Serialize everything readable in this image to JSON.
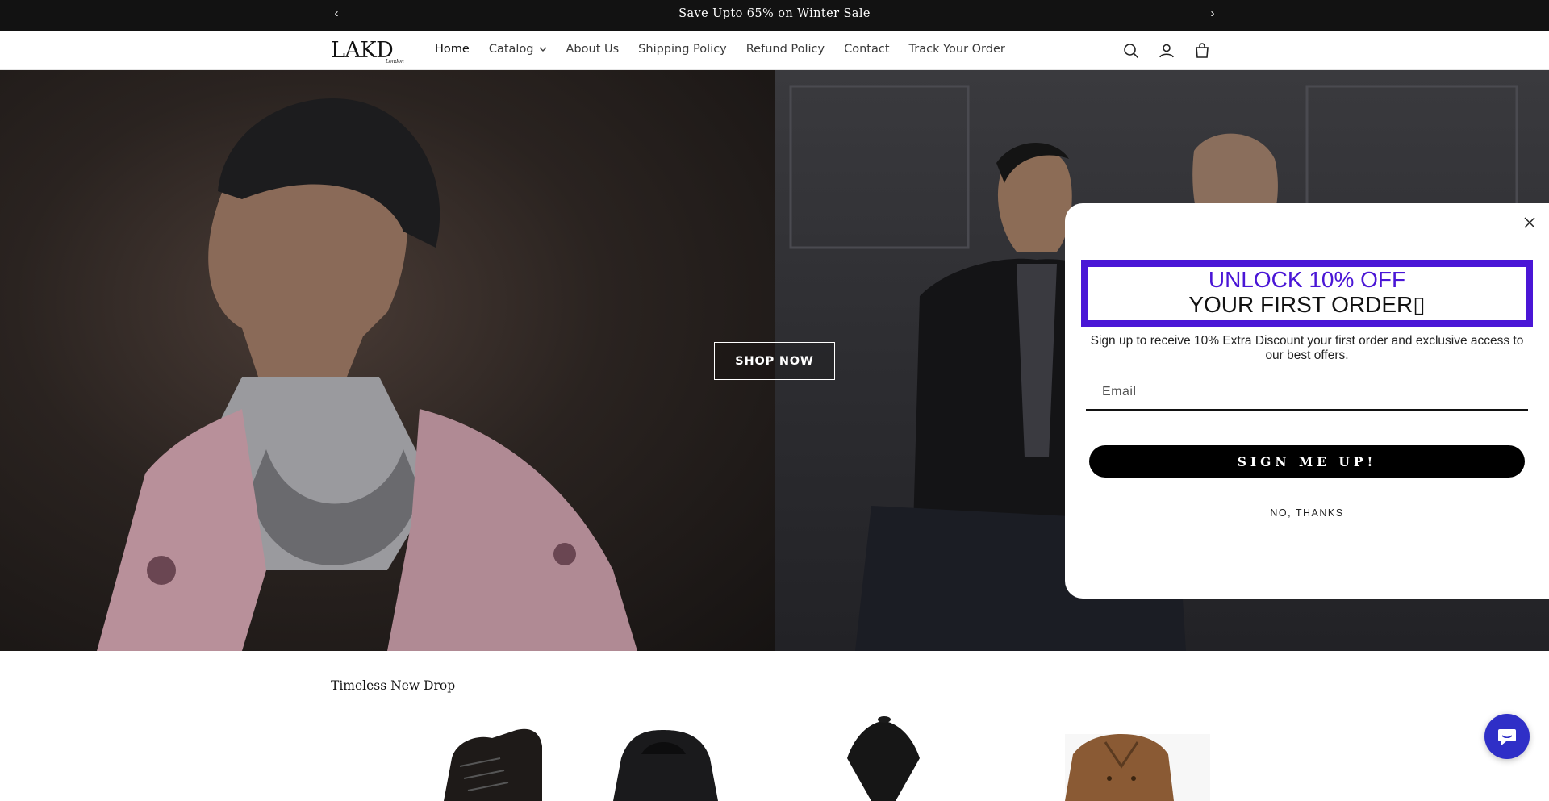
{
  "announcement": {
    "message": "Save Upto 65% on Winter Sale",
    "prev_icon": "chevron-left-icon",
    "next_icon": "chevron-right-icon"
  },
  "header": {
    "logo_text": "LAKD",
    "logo_subtext": "London",
    "nav": [
      {
        "label": "Home",
        "active": true
      },
      {
        "label": "Catalog",
        "has_dropdown": true
      },
      {
        "label": "About Us"
      },
      {
        "label": "Shipping Policy"
      },
      {
        "label": "Refund Policy"
      },
      {
        "label": "Contact"
      },
      {
        "label": "Track Your Order"
      }
    ],
    "icons": [
      "search-icon",
      "account-icon",
      "cart-icon"
    ]
  },
  "hero": {
    "cta_label": "SHOP NOW"
  },
  "popup": {
    "headline_line1": "UNLOCK 10% OFF",
    "headline_line2": "YOUR FIRST ORDER▯",
    "description": "Sign up to receive 10% Extra Discount your first order and exclusive access to our best offers.",
    "email_placeholder": "Email",
    "signup_label": "SIGN ME UP!",
    "decline_label": "NO, THANKS",
    "accent_color": "#4a16d6"
  },
  "section": {
    "title": "Timeless New Drop"
  },
  "chat": {
    "icon": "chat-bubble-icon"
  }
}
